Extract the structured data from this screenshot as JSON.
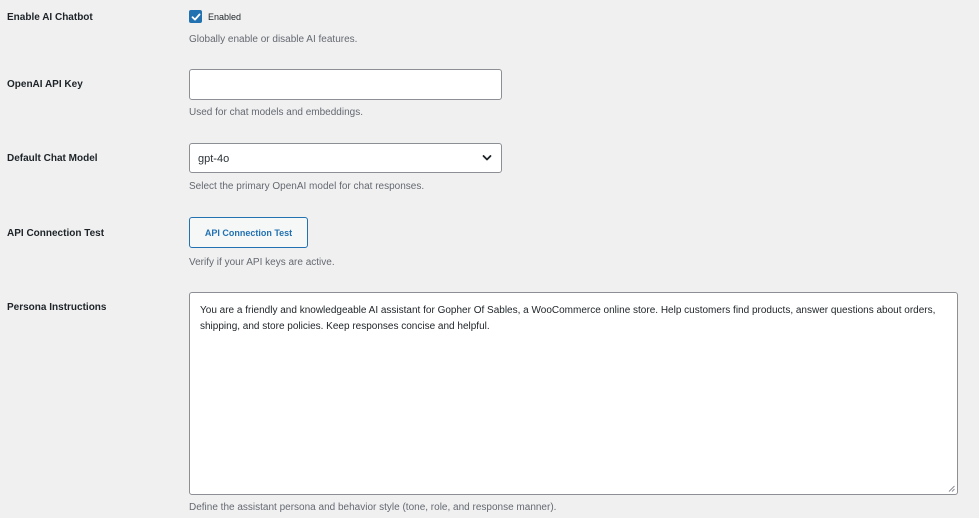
{
  "settings": {
    "enable_chatbot": {
      "label": "Enable AI Chatbot",
      "checkbox_label": "Enabled",
      "checked": true,
      "description": "Globally enable or disable AI features."
    },
    "api_key": {
      "label": "OpenAI API Key",
      "value": "",
      "description": "Used for chat models and embeddings."
    },
    "chat_model": {
      "label": "Default Chat Model",
      "value": "gpt-4o",
      "description": "Select the primary OpenAI model for chat responses."
    },
    "connection_test": {
      "label": "API Connection Test",
      "button_label": "API Connection Test",
      "description": "Verify if your API keys are active."
    },
    "persona": {
      "label": "Persona Instructions",
      "value": "You are a friendly and knowledgeable AI assistant for Gopher Of Sables, a WooCommerce online store. Help customers find products, answer questions about orders, shipping, and store policies. Keep responses concise and helpful.",
      "description": "Define the assistant persona and behavior style (tone, role, and response manner)."
    }
  },
  "colors": {
    "background": "#f0f0f1",
    "accent": "#2271b1",
    "label_text": "#1d2327",
    "description_text": "#646970",
    "field_border": "#8c8f94"
  },
  "icons": {
    "checkbox": "checkmark-icon",
    "select": "chevron-down-icon",
    "textarea": "resize-handle-icon"
  }
}
